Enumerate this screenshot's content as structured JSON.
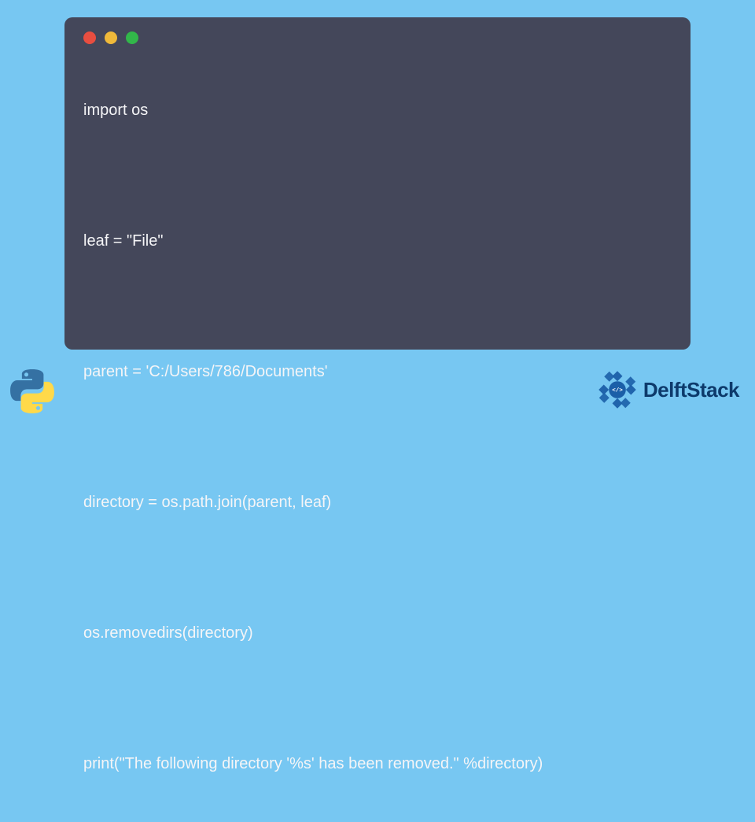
{
  "code": {
    "lines": [
      "import os",
      "",
      "leaf = \"File\"",
      "",
      "parent = 'C:/Users/786/Documents'",
      "",
      "directory = os.path.join(parent, leaf)",
      "",
      "os.removedirs(directory)",
      "",
      "print(\"The following directory '%s' has been removed.\" %directory)"
    ]
  },
  "brand": {
    "name": "DelftStack"
  },
  "colors": {
    "background": "#77c7f2",
    "code_bg": "#44475a",
    "code_text": "#f5f5f7",
    "dot_red": "#e84e40",
    "dot_yellow": "#f0b93a",
    "dot_green": "#32b74a",
    "brand_text": "#0d3a6b"
  }
}
